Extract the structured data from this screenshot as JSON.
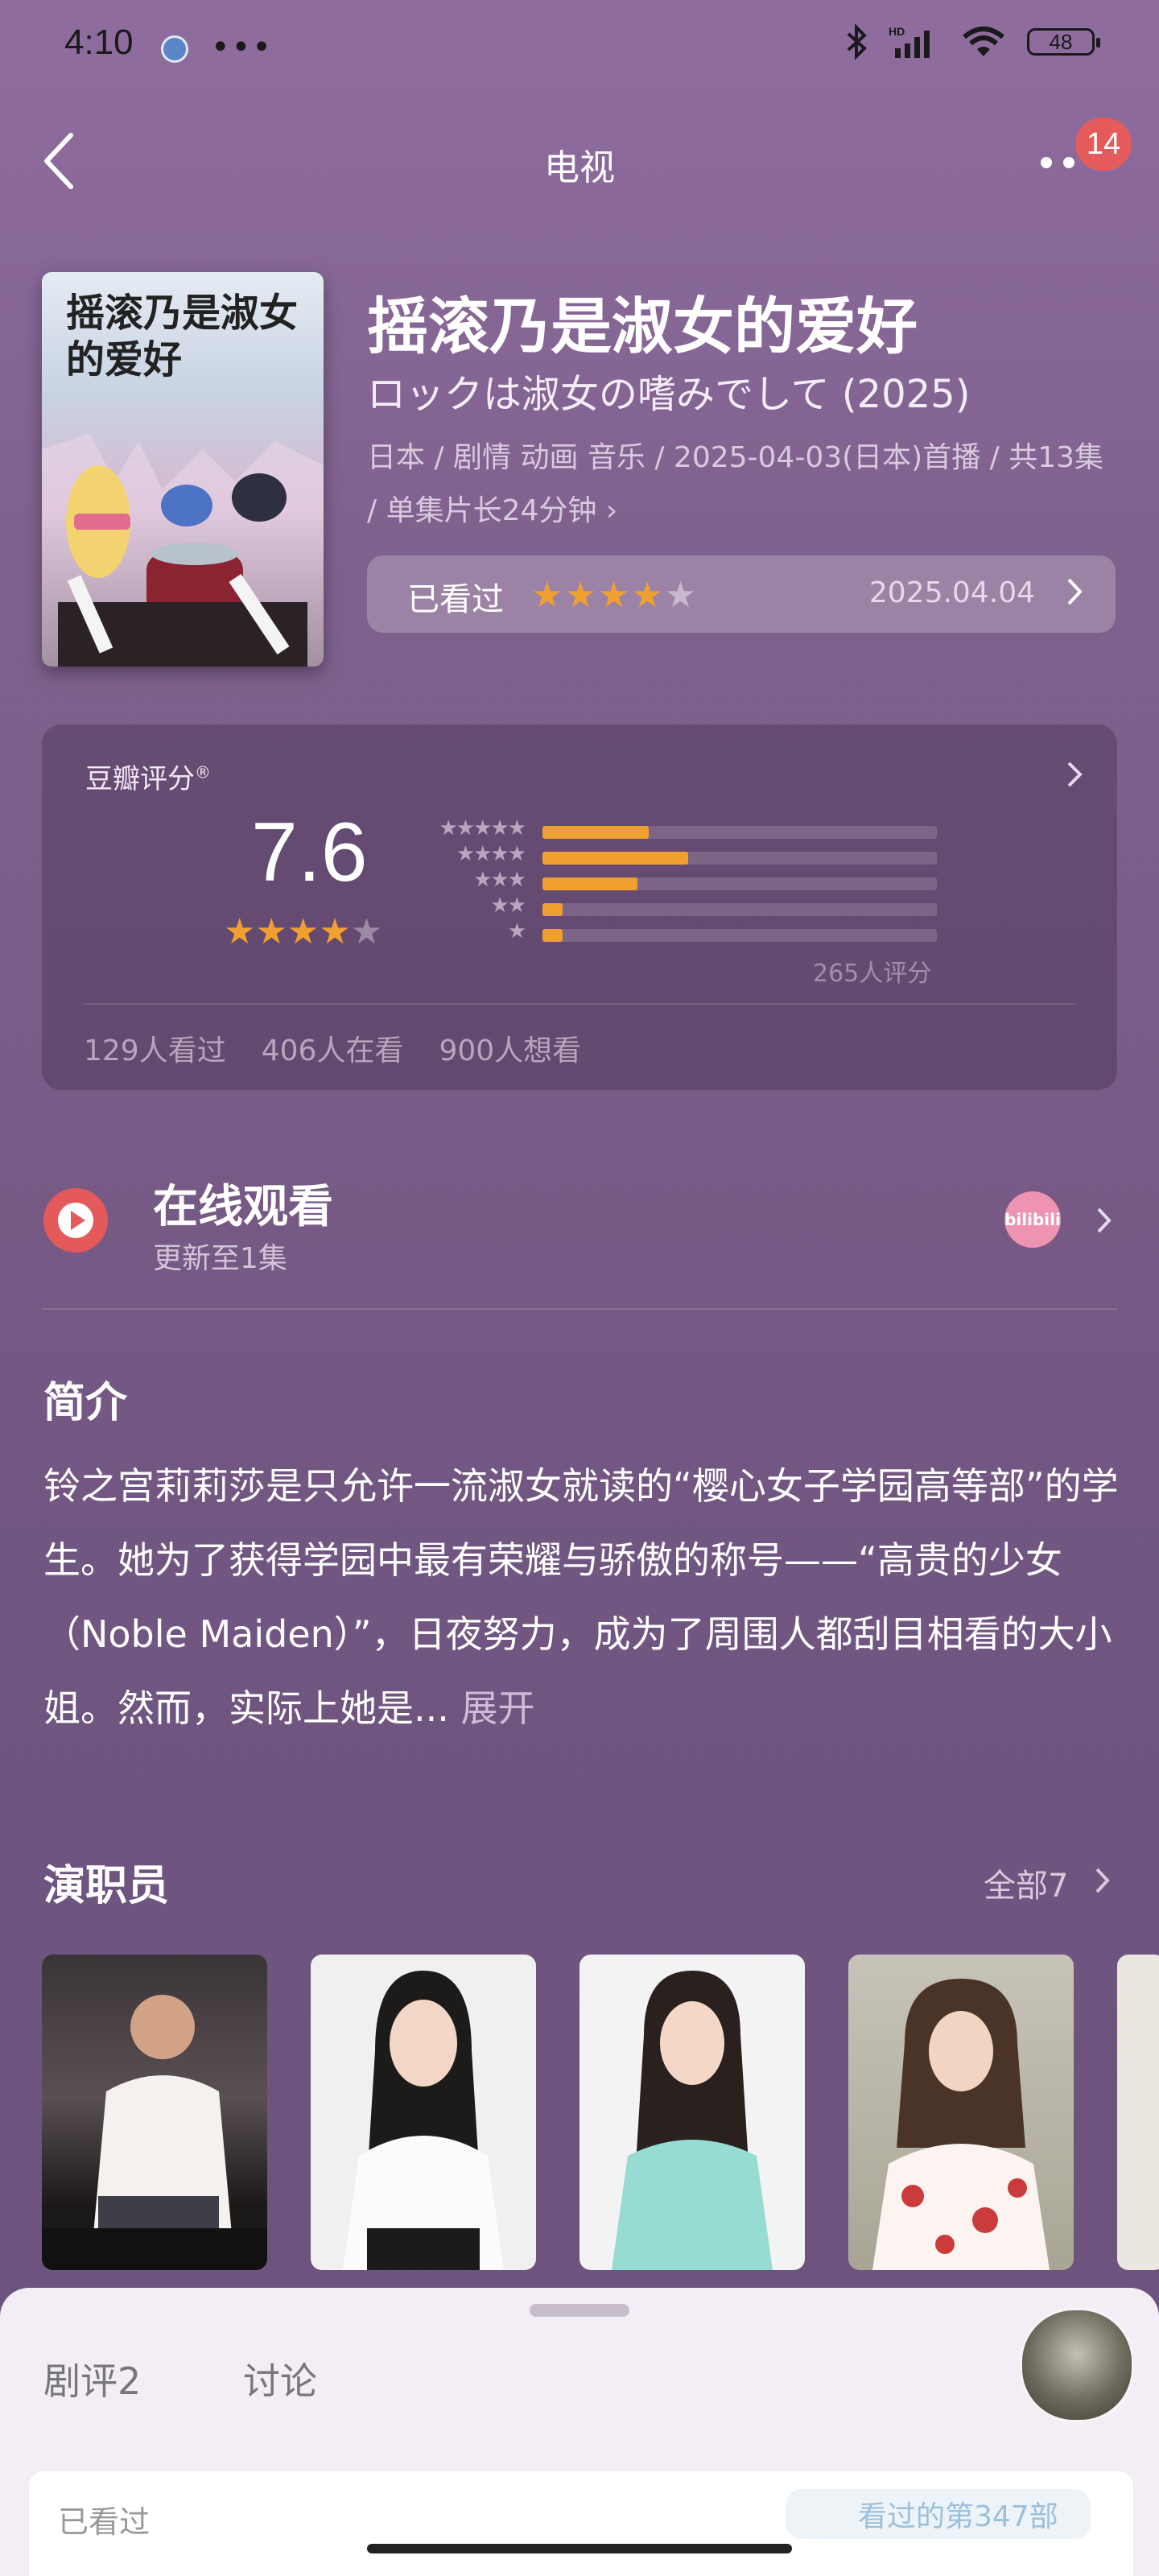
{
  "status_bar": {
    "time": "4:10",
    "battery": "48"
  },
  "nav": {
    "title": "电视",
    "notification_count": "14"
  },
  "movie": {
    "title_cn": "摇滚乃是淑女的爱好",
    "title_jp": "ロックは淑女の嗜みでして (2025)",
    "meta": "日本 / 剧情 动画 音乐 / 2025-04-03(日本)首播 / 共13集 / 单集片长24分钟 ›",
    "poster_title": "摇滚乃是淑女的爱好"
  },
  "my_rating": {
    "label": "已看过",
    "stars": 4,
    "date": "2025.04.04"
  },
  "douban": {
    "label": "豆瓣评分",
    "score": "7.6",
    "stars": 4,
    "distribution": [
      {
        "stars": "★★★★★",
        "fraction": 0.27
      },
      {
        "stars": "★★★★",
        "fraction": 0.37
      },
      {
        "stars": "★★★",
        "fraction": 0.24
      },
      {
        "stars": "★★",
        "fraction": 0.05
      },
      {
        "stars": "★",
        "fraction": 0.05
      }
    ],
    "count": "265人评分",
    "watched": "129人看过",
    "watching": "406人在看",
    "want": "900人想看"
  },
  "online": {
    "title": "在线观看",
    "subtitle": "更新至1集",
    "platform_label": "bilibili"
  },
  "intro": {
    "title": "简介",
    "text": "铃之宫莉莉莎是只允许一流淑女就读的“樱心女子学园高等部”的学生。她为了获得学园中最有荣耀与骄傲的称号——“高贵的少女（Noble Maiden）”，日夜努力，成为了周围人都刮目相看的大小姐。然而，实际上她是...",
    "more": "展开"
  },
  "cast": {
    "title": "演职员",
    "all": "全部7"
  },
  "sheet": {
    "tab_reviews": "剧评2",
    "tab_discuss": "讨论",
    "seen": "已看过",
    "rank": "看过的第347部"
  },
  "colors": {
    "accent": "#f0a030",
    "play": "#e45a5a",
    "badge": "#e55a5a"
  }
}
